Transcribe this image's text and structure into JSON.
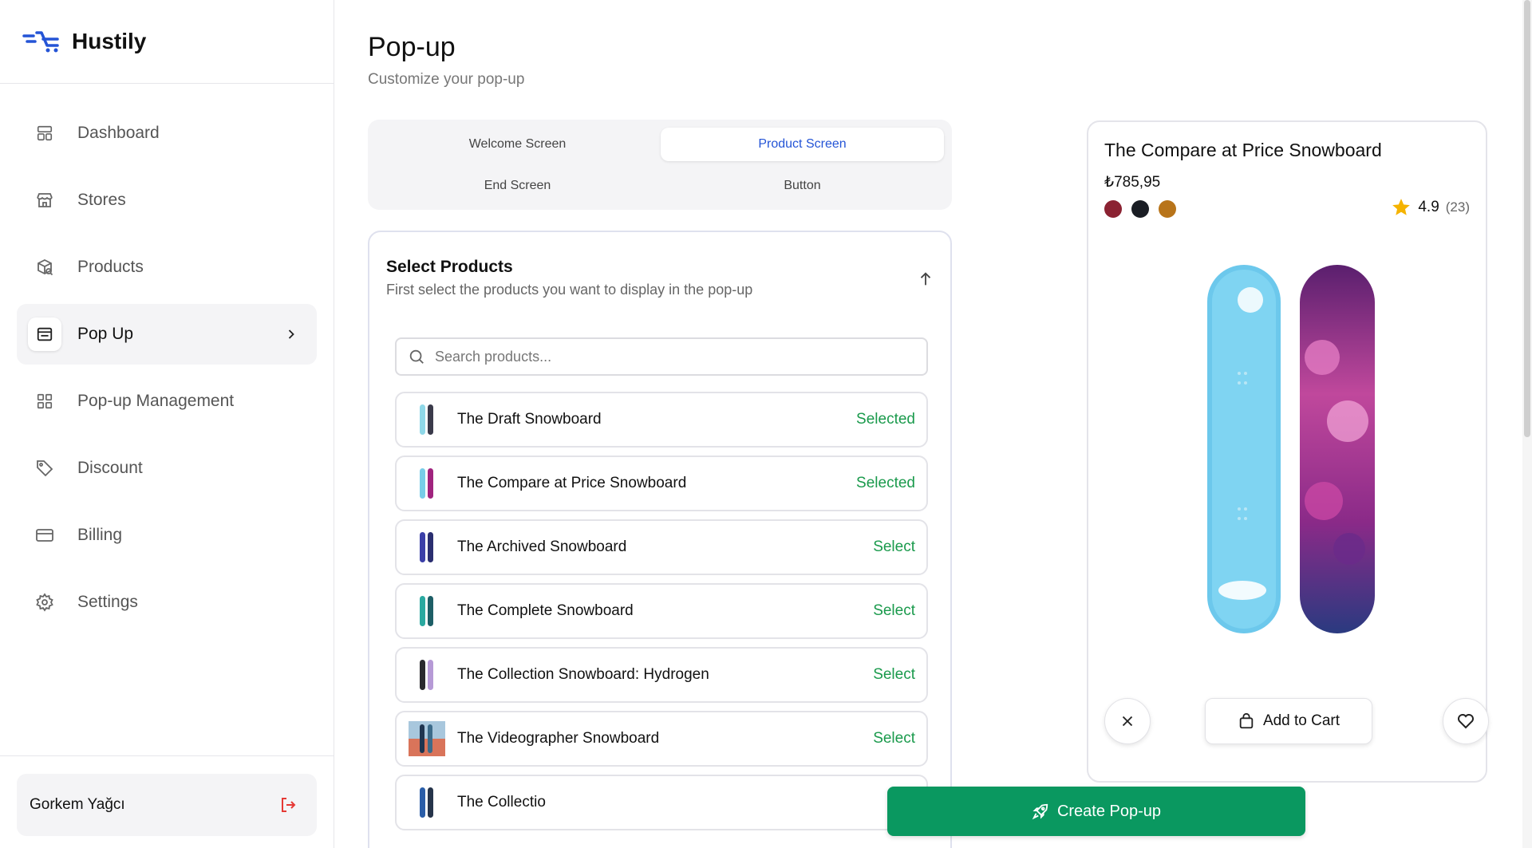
{
  "brand": {
    "name": "Hustily",
    "logo_icon": "hustily-cart-logo-icon",
    "accent": "#2454d6"
  },
  "sidebar": {
    "items": [
      {
        "label": "Dashboard",
        "icon": "dashboard-icon"
      },
      {
        "label": "Stores",
        "icon": "store-icon"
      },
      {
        "label": "Products",
        "icon": "package-icon"
      },
      {
        "label": "Pop Up",
        "icon": "popup-icon",
        "active": true
      },
      {
        "label": "Pop-up Management",
        "icon": "grid-icon"
      },
      {
        "label": "Discount",
        "icon": "tag-icon"
      },
      {
        "label": "Billing",
        "icon": "credit-card-icon"
      },
      {
        "label": "Settings",
        "icon": "gear-icon"
      }
    ],
    "user": {
      "name": "Gorkem Yağcı"
    }
  },
  "header": {
    "title": "Pop-up",
    "subtitle": "Customize your pop-up"
  },
  "tabs": [
    {
      "label": "Welcome Screen",
      "active": false
    },
    {
      "label": "Product Screen",
      "active": true
    },
    {
      "label": "End Screen",
      "active": false
    },
    {
      "label": "Button",
      "active": false
    }
  ],
  "select_products": {
    "title": "Select Products",
    "description": "First select the products you want to display in the pop-up",
    "search_placeholder": "Search products...",
    "items": [
      {
        "name": "The Draft Snowboard",
        "status": "Selected"
      },
      {
        "name": "The Compare at Price Snowboard",
        "status": "Selected"
      },
      {
        "name": "The Archived Snowboard",
        "status": "Select"
      },
      {
        "name": "The Complete Snowboard",
        "status": "Select"
      },
      {
        "name": "The Collection Snowboard: Hydrogen",
        "status": "Select"
      },
      {
        "name": "The Videographer Snowboard",
        "status": "Select"
      },
      {
        "name": "The Collectio",
        "status": ""
      }
    ],
    "status_color": "#1a9a4c"
  },
  "create_button": {
    "label": "Create Pop-up",
    "color": "#0a9860"
  },
  "preview": {
    "title": "The Compare at Price Snowboard",
    "price": "₺785,95",
    "swatches": [
      "#8b2232",
      "#1a1d24",
      "#b8741a"
    ],
    "rating": "4.9",
    "rating_count": "(23)",
    "add_to_cart_label": "Add to Cart"
  }
}
